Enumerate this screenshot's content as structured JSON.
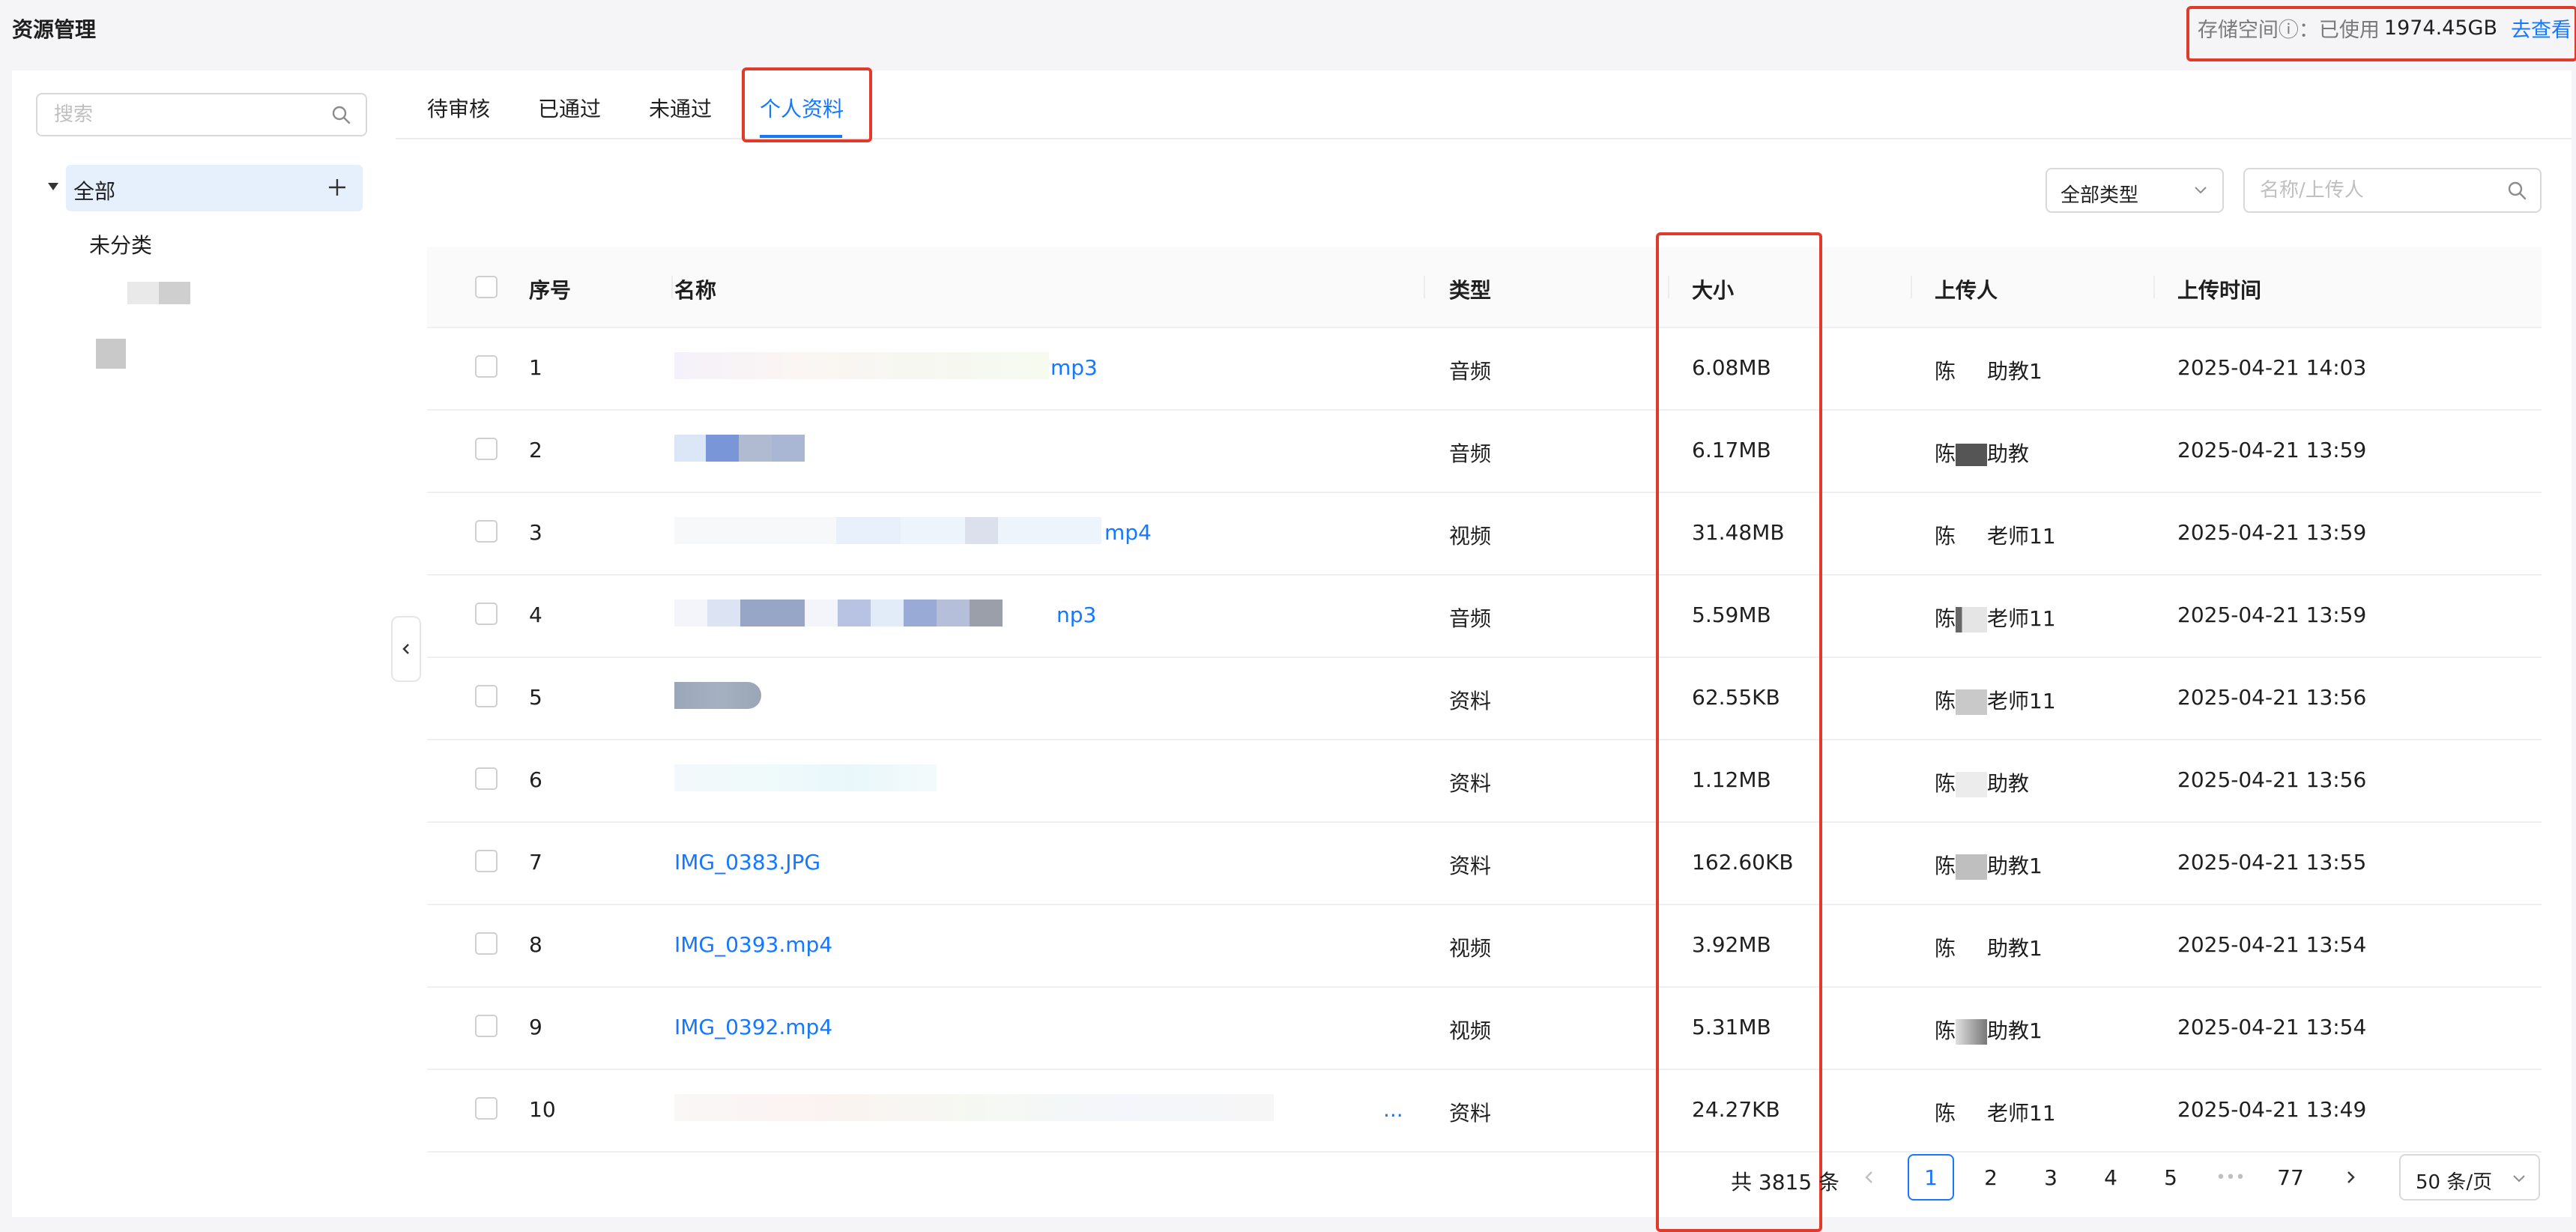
{
  "header": {
    "title": "资源管理",
    "storage_label": "存储空间ⓘ：已使用",
    "storage_used": "1974.45GB",
    "storage_link": "去查看"
  },
  "sidebar": {
    "search_placeholder": "搜索",
    "tree_all": "全部",
    "tree_uncategorized": "未分类"
  },
  "tabs": [
    {
      "label": "待审核",
      "active": false
    },
    {
      "label": "已通过",
      "active": false
    },
    {
      "label": "未通过",
      "active": false
    },
    {
      "label": "个人资料",
      "active": true
    }
  ],
  "filters": {
    "type_select": "全部类型",
    "search_placeholder": "名称/上传人"
  },
  "table": {
    "columns": [
      "序号",
      "名称",
      "类型",
      "大小",
      "上传人",
      "上传时间"
    ],
    "rows": [
      {
        "no": "1",
        "name": "mp3",
        "type": "音频",
        "size": "6.08MB",
        "uploader_a": "陈",
        "uploader_b": "助教1",
        "time": "2025-04-21 14:03"
      },
      {
        "no": "2",
        "name": "",
        "type": "音频",
        "size": "6.17MB",
        "uploader_a": "陈",
        "uploader_b": "助教",
        "time": "2025-04-21 13:59"
      },
      {
        "no": "3",
        "name": "mp4",
        "type": "视频",
        "size": "31.48MB",
        "uploader_a": "陈",
        "uploader_b": "老师11",
        "time": "2025-04-21 13:59"
      },
      {
        "no": "4",
        "name": "np3",
        "type": "音频",
        "size": "5.59MB",
        "uploader_a": "陈",
        "uploader_b": "老师11",
        "time": "2025-04-21 13:59"
      },
      {
        "no": "5",
        "name": "",
        "type": "资料",
        "size": "62.55KB",
        "uploader_a": "陈",
        "uploader_b": "老师11",
        "time": "2025-04-21 13:56"
      },
      {
        "no": "6",
        "name": "",
        "type": "资料",
        "size": "1.12MB",
        "uploader_a": "陈",
        "uploader_b": "助教",
        "time": "2025-04-21 13:56"
      },
      {
        "no": "7",
        "name": "IMG_0383.JPG",
        "type": "资料",
        "size": "162.60KB",
        "uploader_a": "陈",
        "uploader_b": "助教1",
        "time": "2025-04-21 13:55"
      },
      {
        "no": "8",
        "name": "IMG_0393.mp4",
        "type": "视频",
        "size": "3.92MB",
        "uploader_a": "陈",
        "uploader_b": "助教1",
        "time": "2025-04-21 13:54"
      },
      {
        "no": "9",
        "name": "IMG_0392.mp4",
        "type": "视频",
        "size": "5.31MB",
        "uploader_a": "陈",
        "uploader_b": "助教1",
        "time": "2025-04-21 13:54"
      },
      {
        "no": "10",
        "name": "...",
        "type": "资料",
        "size": "24.27KB",
        "uploader_a": "陈",
        "uploader_b": "老师11",
        "time": "2025-04-21 13:49"
      }
    ]
  },
  "pagination": {
    "total": "共 3815 条",
    "pages": [
      "1",
      "2",
      "3",
      "4",
      "5"
    ],
    "ellipsis": "•••",
    "last": "77",
    "page_size": "50 条/页",
    "current": "1"
  },
  "colors": {
    "accent": "#1677ff",
    "highlight": "#e23a2a"
  }
}
